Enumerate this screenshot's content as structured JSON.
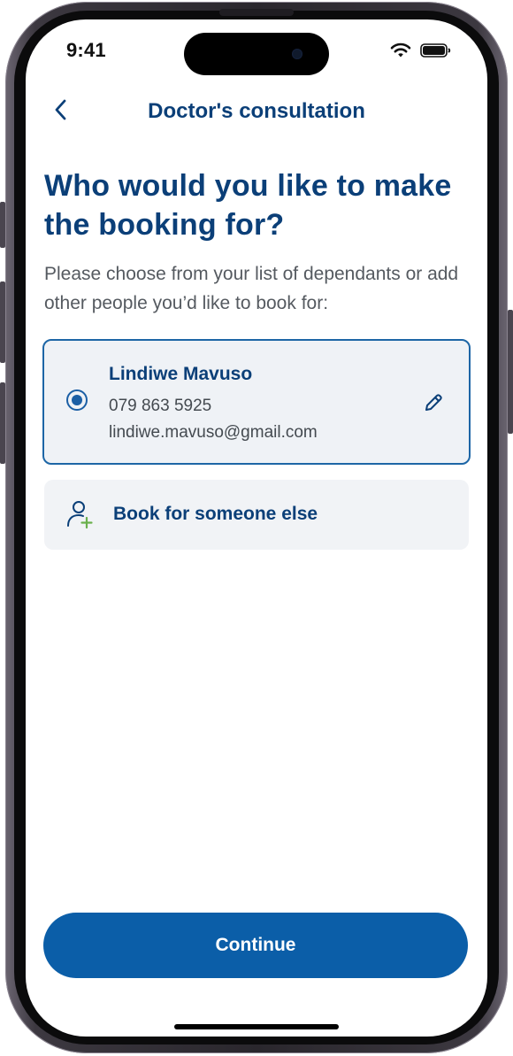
{
  "status_bar": {
    "time": "9:41",
    "icons": [
      "wifi-icon",
      "battery-icon"
    ]
  },
  "header": {
    "back_icon": "chevron-left-icon",
    "title": "Doctor's consultation"
  },
  "heading": "Who would you like to make the booking for?",
  "subtext": "Please choose from your list of dependants or add other people you’d like to book for:",
  "selected_dependant": {
    "name": "Lindiwe Mavuso",
    "phone": "079 863 5925",
    "email": "lindiwe.mavuso@gmail.com",
    "selected": true,
    "edit_icon": "pencil-icon"
  },
  "book_other": {
    "icon": "add-person-icon",
    "label": "Book for someone else"
  },
  "continue_label": "Continue",
  "colors": {
    "primary": "#0b3f78",
    "button": "#0b5ea8",
    "selected_border": "#1d66a6",
    "card_bg": "#eff2f6",
    "accent_plus": "#6ab04c"
  }
}
